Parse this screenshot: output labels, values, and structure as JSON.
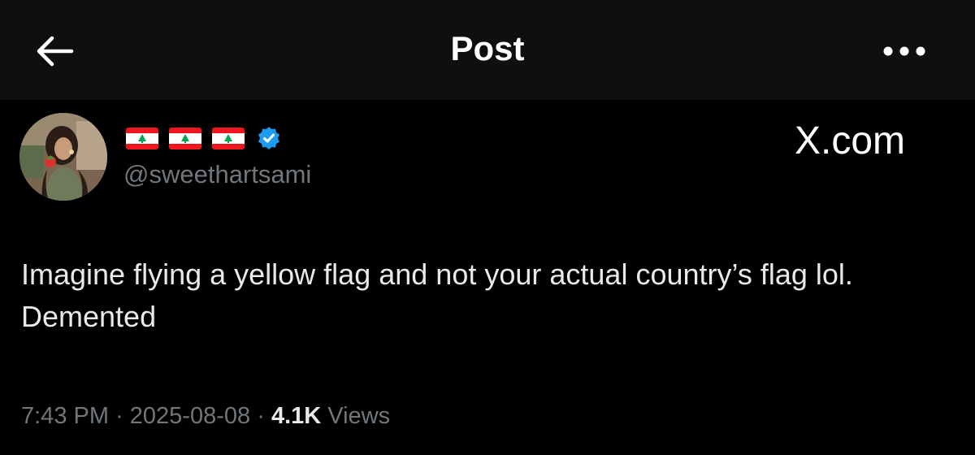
{
  "header": {
    "title": "Post",
    "back_icon": "arrow-left-icon",
    "more_icon": "more-horizontal-icon"
  },
  "post": {
    "author": {
      "display_name_flags": [
        "lebanon-flag",
        "lebanon-flag",
        "lebanon-flag"
      ],
      "verified": true,
      "handle": "@sweethartsami"
    },
    "source_badge": "X.com",
    "text": "Imagine flying a yellow flag and not your actual country’s flag lol. Demented",
    "meta": {
      "time": "7:43 PM",
      "separator": "·",
      "date": "2025-08-08",
      "views_count": "4.1K",
      "views_label": "Views"
    }
  },
  "colors": {
    "background": "#000000",
    "header_bg": "#0f0f0f",
    "primary_text": "#e7e9ea",
    "secondary_text": "#71767b",
    "verified_blue": "#1d9bf0",
    "flag_red": "#ee161f",
    "cedar_green": "#00a651"
  }
}
